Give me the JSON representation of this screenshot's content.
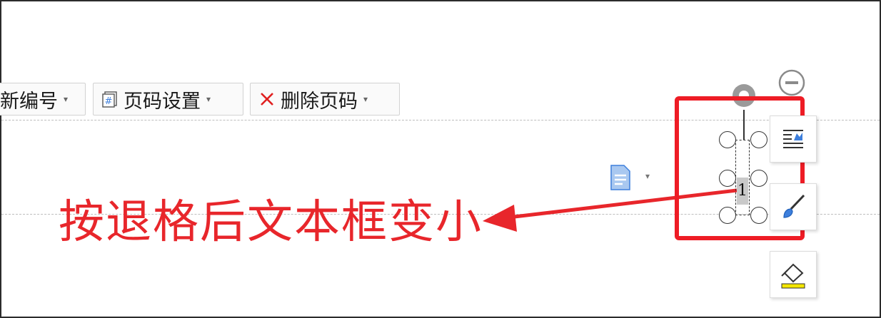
{
  "toolbar": {
    "renumber_label": "新编号",
    "page_setup_label": "页码设置",
    "delete_page_label": "删除页码",
    "caret": "▾"
  },
  "annotation": {
    "text": "按退格后文本框变小"
  },
  "page_number": {
    "value": "1"
  },
  "colors": {
    "annotation_red": "#e8262b",
    "highlight_red": "#ee1c25",
    "accent_blue": "#3d7fdc",
    "marker_yellow": "#f3e600"
  },
  "icons": {
    "page_setup": "page-number-hash-icon",
    "delete": "red-x-icon",
    "doc": "document-icon",
    "rotate": "rotate-handle-icon",
    "collapse": "minus-circle-icon",
    "layout": "text-wrap-icon",
    "brush": "paintbrush-icon",
    "fill": "fill-bucket-icon"
  }
}
